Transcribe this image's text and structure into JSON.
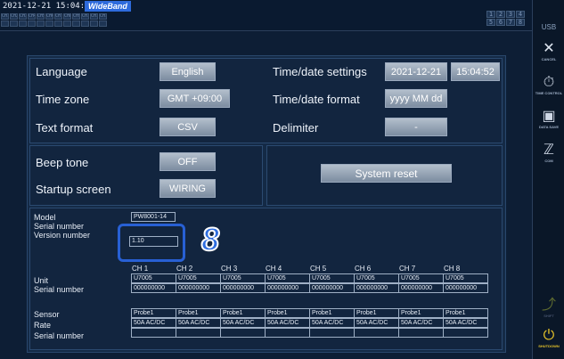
{
  "status": {
    "datetime": "2021-12-21  15:04:52",
    "badge": "WideBand"
  },
  "channel_indicators": {
    "top": [
      "CH1",
      "CH2",
      "CH3",
      "CH4",
      "CH5",
      "CH6",
      "CH7",
      "CH8",
      "CH9",
      "CH10",
      "CH11",
      "CH12"
    ],
    "bottom": [
      "",
      "",
      "",
      "",
      "",
      "",
      "",
      "",
      "",
      "",
      "",
      ""
    ]
  },
  "unit_grid": [
    "1",
    "2",
    "3",
    "4",
    "5",
    "6",
    "7",
    "8"
  ],
  "sidebar": {
    "usb": "USB",
    "items": [
      {
        "label": "CANCEL",
        "icon": "cancel-icon"
      },
      {
        "label": "TIME CONTROL",
        "icon": "time-control-icon"
      },
      {
        "label": "DATA SAVE",
        "icon": "data-save-icon"
      },
      {
        "label": "COM",
        "icon": "com-icon"
      },
      {
        "label": "SHIFT",
        "icon": "shift-icon"
      },
      {
        "label": "SHUTDOWN",
        "icon": "shutdown-icon"
      }
    ]
  },
  "settings": {
    "language_label": "Language",
    "language_value": "English",
    "timezone_label": "Time zone",
    "timezone_value": "GMT +09:00",
    "textformat_label": "Text format",
    "textformat_value": "CSV",
    "timedate_label": "Time/date settings",
    "date_value": "2021-12-21",
    "time_value": "15:04:52",
    "timedateformat_label": "Time/date format",
    "timedateformat_value": "yyyy MM dd",
    "delimiter_label": "Delimiter",
    "delimiter_value": "-",
    "beep_label": "Beep tone",
    "beep_value": "OFF",
    "startup_label": "Startup screen",
    "startup_value": "WIRING",
    "system_reset": "System reset"
  },
  "info": {
    "model_label": "Model",
    "model_value": "PW8001-14",
    "serial_label": "Serial number",
    "version_label": "Version number",
    "version_value": "1.10",
    "callout": "8",
    "channels": [
      "CH 1",
      "CH 2",
      "CH 3",
      "CH 4",
      "CH 5",
      "CH 6",
      "CH 7",
      "CH 8"
    ],
    "unit_label": "Unit",
    "unit_serial_label": "Serial number",
    "units": [
      "U7005",
      "U7005",
      "U7005",
      "U7005",
      "U7005",
      "U7005",
      "U7005",
      "U7005"
    ],
    "unit_serials": [
      "000000000",
      "000000000",
      "000000000",
      "000000000",
      "000000000",
      "000000000",
      "000000000",
      "000000000"
    ],
    "sensor_label": "Sensor",
    "rate_label": "Rate",
    "sensor_serial_label": "Serial number",
    "sensors": [
      "Probe1",
      "Probe1",
      "Probe1",
      "Probe1",
      "Probe1",
      "Probe1",
      "Probe1",
      "Probe1"
    ],
    "rates": [
      "50A AC/DC",
      "50A AC/DC",
      "50A AC/DC",
      "50A AC/DC",
      "50A AC/DC",
      "50A AC/DC",
      "50A AC/DC",
      "50A AC/DC"
    ]
  }
}
